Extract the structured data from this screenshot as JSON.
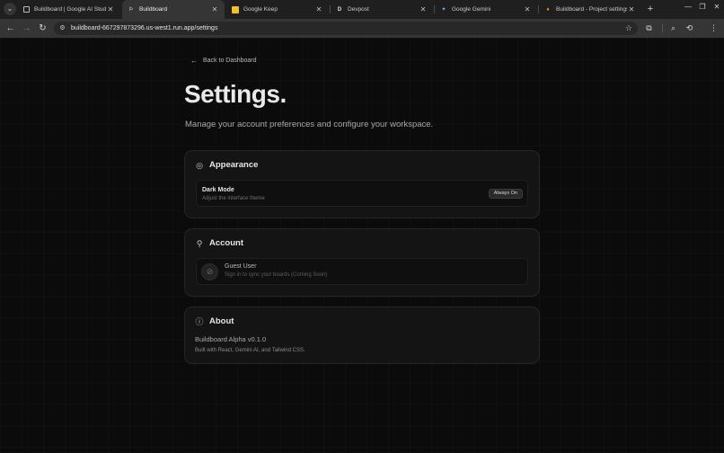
{
  "browser": {
    "tabs": [
      {
        "title": "Buildboard | Google AI Studio",
        "favicon": "ai-studio-icon",
        "active": false
      },
      {
        "title": "Buildboard",
        "favicon": "buildboard-icon",
        "active": true
      },
      {
        "title": "Google Keep",
        "favicon": "keep-icon",
        "active": false
      },
      {
        "title": "Devpost",
        "favicon": "devpost-icon",
        "active": false
      },
      {
        "title": "Google Gemini",
        "favicon": "gemini-icon",
        "active": false
      },
      {
        "title": "Buildboard - Project settings",
        "favicon": "firebase-icon",
        "active": false
      }
    ],
    "url": "buildboard-667297873296.us-west1.run.app/settings",
    "colors": {
      "tabstrip": "#1f1f1f",
      "toolbar": "#353535",
      "omnibox": "#282828"
    }
  },
  "page": {
    "back_label": "Back to Dashboard",
    "title": "Settings.",
    "subtitle": "Manage your account preferences and configure your workspace.",
    "appearance": {
      "heading": "Appearance",
      "row_title": "Dark Mode",
      "row_desc": "Adjust the interface theme",
      "badge": "Always On"
    },
    "account": {
      "heading": "Account",
      "name": "Guest User",
      "desc": "Sign in to sync your boards (Coming Soon)"
    },
    "about": {
      "heading": "About",
      "version": "Buildboard Alpha v0.1.0",
      "built": "Built with React, Gemini AI, and Tailwind CSS."
    }
  }
}
